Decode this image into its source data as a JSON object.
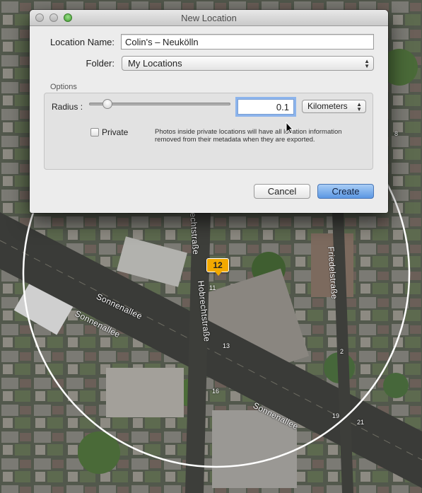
{
  "dialog": {
    "title": "New Location",
    "location_name_label": "Location Name:",
    "location_name_value": "Colin's – Neukölln",
    "folder_label": "Folder:",
    "folder_value": "My Locations",
    "options_label": "Options",
    "radius_label": "Radius :",
    "radius_value": "0.1",
    "unit_value": "Kilometers",
    "private_label": "Private",
    "private_checked": false,
    "private_help": "Photos inside private locations will have all location information removed from their metadata when they are exported.",
    "cancel_label": "Cancel",
    "create_label": "Create"
  },
  "map": {
    "streets": [
      "Sonnenallee",
      "Sonnenallee",
      "Sonnenallee",
      "Hobrechtstraße",
      "Friedelstraße",
      "echtstraße"
    ],
    "house_numbers": [
      "11",
      "13",
      "16",
      "19",
      "21",
      "2",
      "8"
    ],
    "photo_count": "12"
  }
}
